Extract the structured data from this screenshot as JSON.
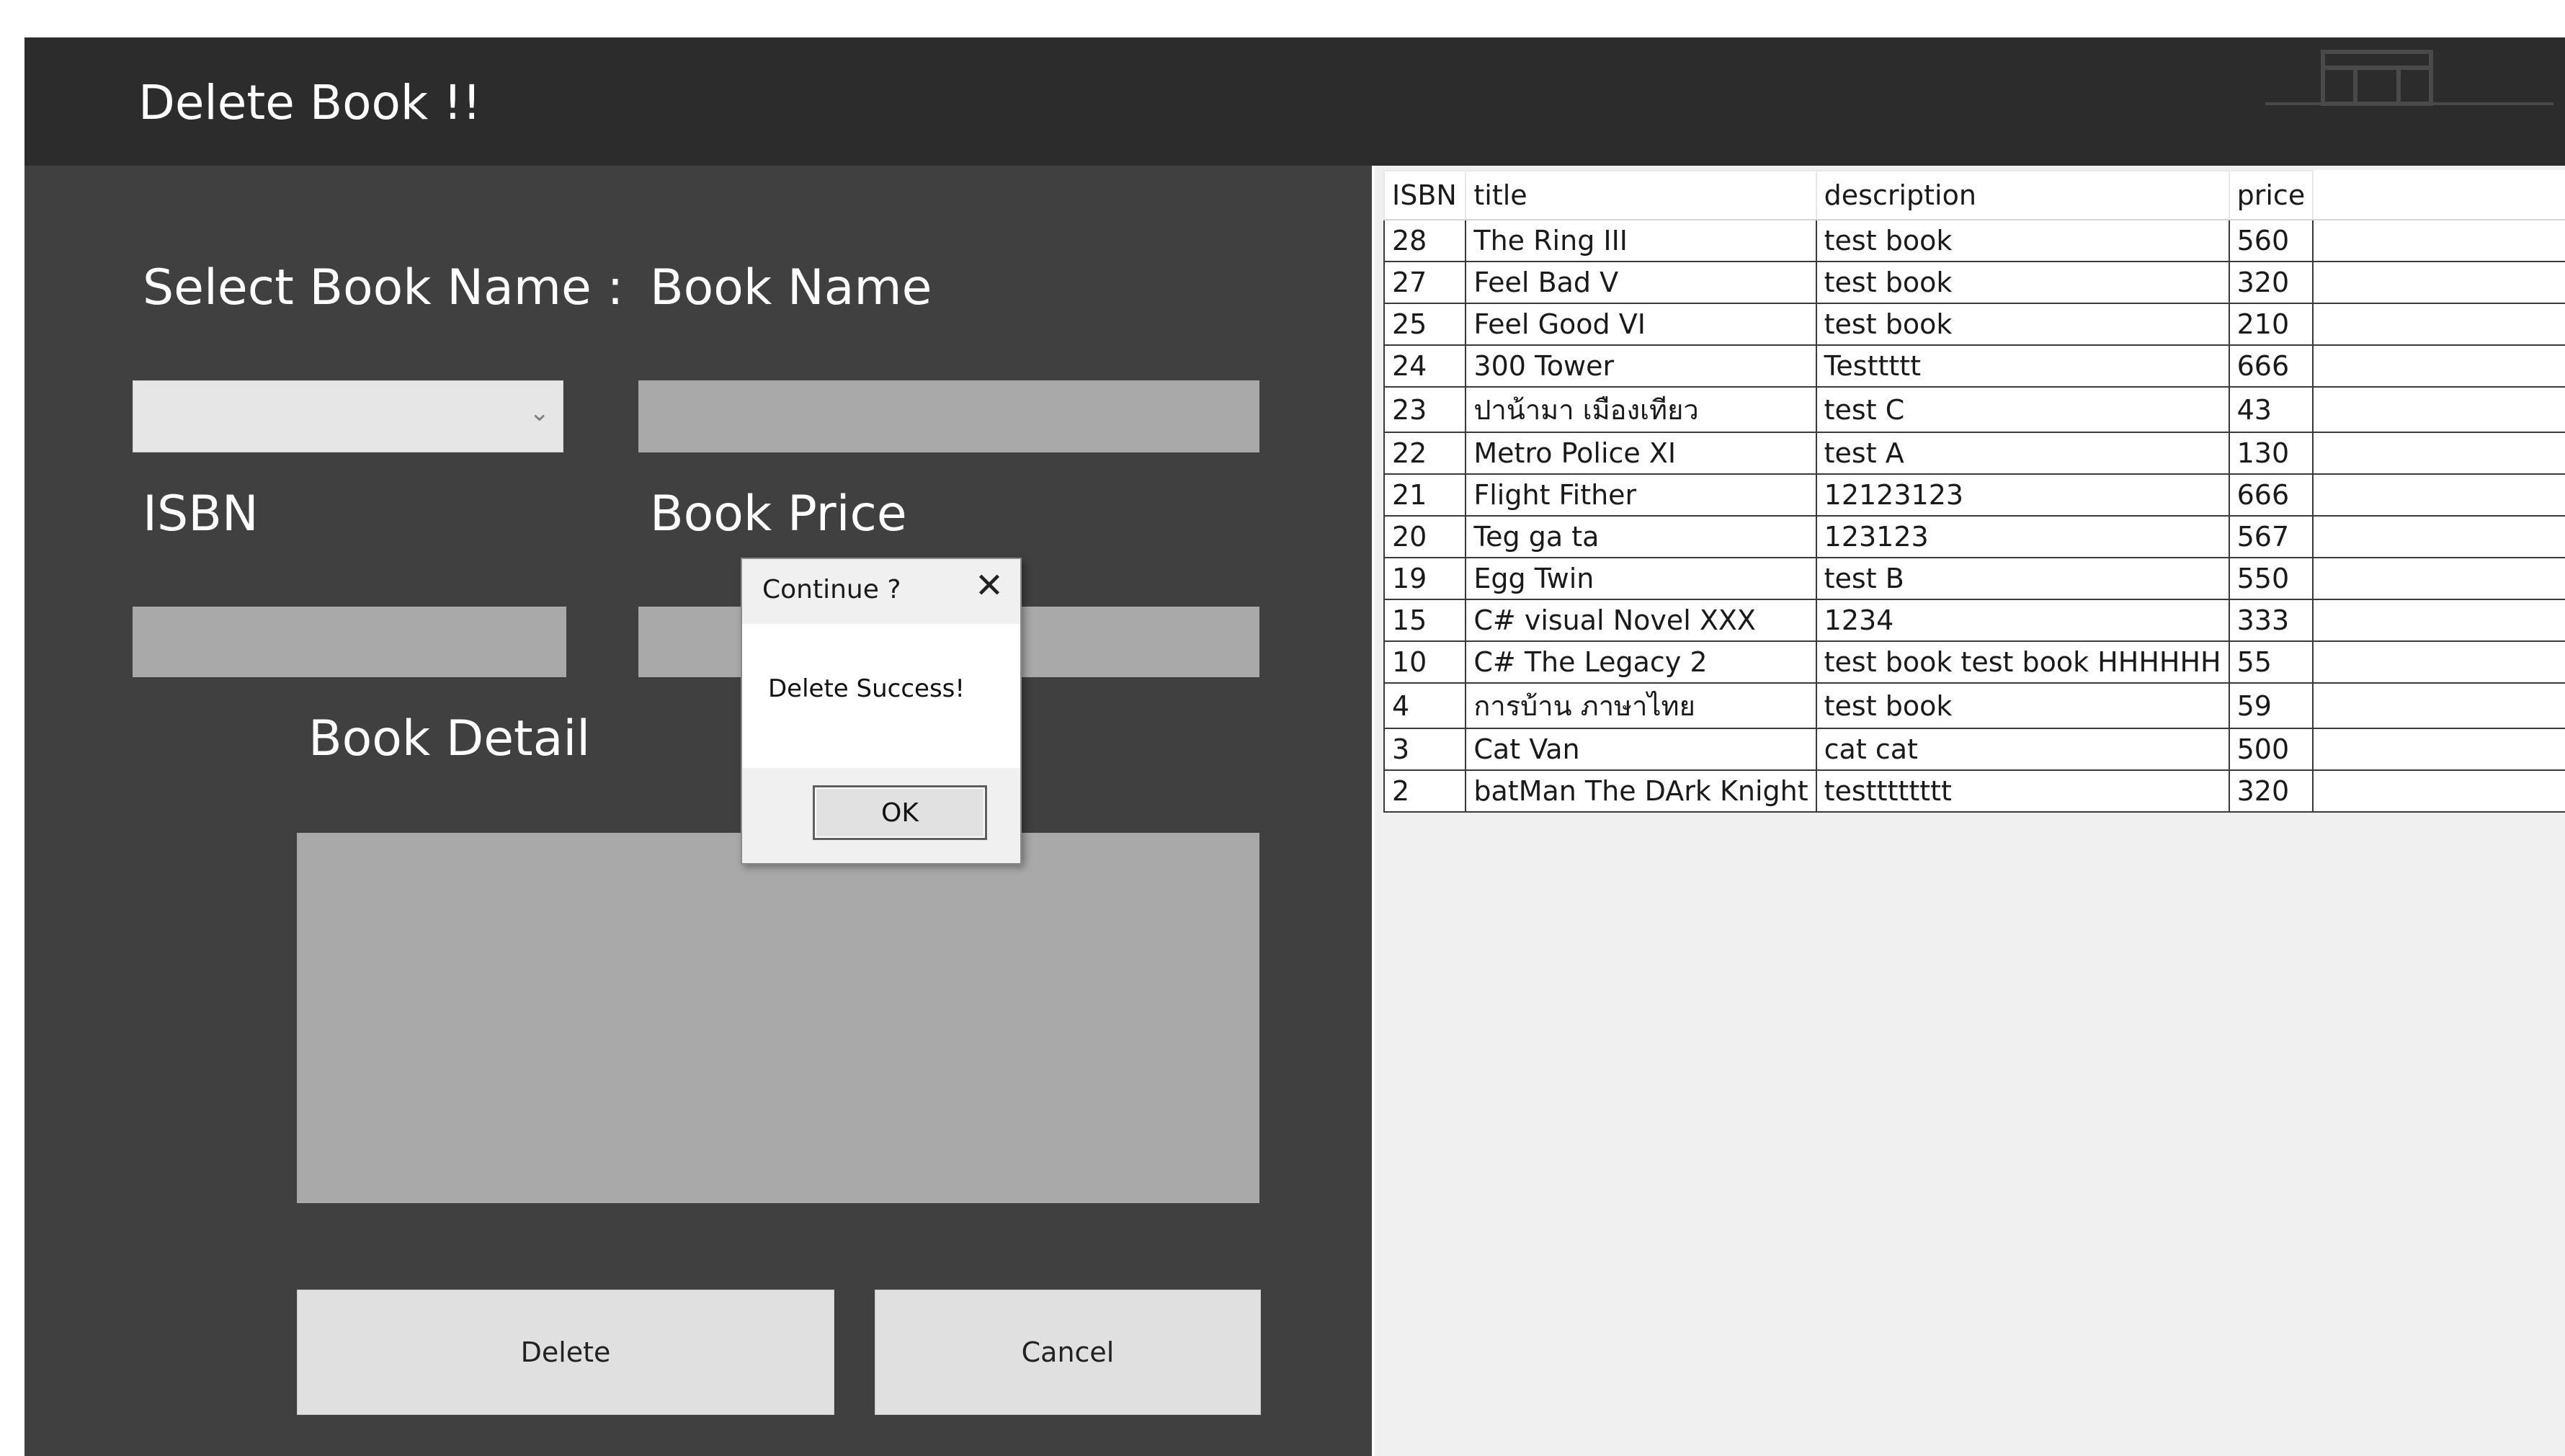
{
  "window": {
    "title": "Delete Book !!"
  },
  "form": {
    "select_book_label": "Select Book Name :",
    "book_name_label": "Book Name",
    "isbn_label": "ISBN",
    "book_price_label": "Book Price",
    "book_detail_label": "Book Detail",
    "select_book_value": "",
    "book_name_value": "",
    "isbn_value": "",
    "book_price_value": "",
    "book_detail_value": "",
    "delete_button": "Delete",
    "cancel_button": "Cancel"
  },
  "grid": {
    "columns": [
      "ISBN",
      "title",
      "description",
      "price"
    ],
    "rows": [
      [
        "28",
        "The Ring III",
        "test book",
        "560"
      ],
      [
        "27",
        "Feel Bad V",
        "test book",
        "320"
      ],
      [
        "25",
        "Feel Good VI",
        "test book",
        "210"
      ],
      [
        "24",
        "300 Tower",
        "Testtttt",
        "666"
      ],
      [
        "23",
        "ปาน้ามา เมืองเทียว",
        "test C",
        "43"
      ],
      [
        "22",
        "Metro Police XI",
        "test A",
        "130"
      ],
      [
        "21",
        "Flight Fither",
        "12123123",
        "666"
      ],
      [
        "20",
        "Teg ga ta",
        "123123",
        "567"
      ],
      [
        "19",
        "Egg Twin",
        "test B",
        "550"
      ],
      [
        "15",
        "C# visual Novel XXX",
        "1234",
        "333"
      ],
      [
        "10",
        "C# The Legacy 2",
        "test book test book HHHHHH",
        "55"
      ],
      [
        "4",
        "การบ้าน ภาษาไทย",
        "test book",
        "59"
      ],
      [
        "3",
        "Cat Van",
        "cat cat",
        "500"
      ],
      [
        "2",
        "batMan The DArk Knight",
        "testttttttt",
        "320"
      ]
    ]
  },
  "dialog": {
    "title": "Continue ?",
    "message": "Delete Success!",
    "ok_button": "OK",
    "close_glyph": "✕"
  },
  "colors": {
    "titlebar": "#2c2c2c",
    "form_bg": "#404040",
    "field": "#a9a9a9",
    "grid_bg": "#f0f0f0"
  }
}
